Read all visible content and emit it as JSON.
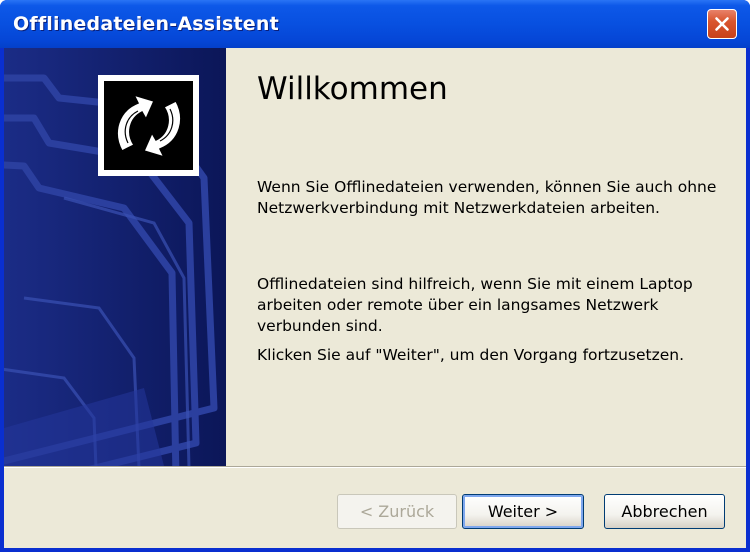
{
  "window": {
    "title": "Offlinedateien-Assistent",
    "close_icon": "close-icon",
    "close_color": "#d9562f",
    "titlebar_color": "#0850e0"
  },
  "banner": {
    "logo_icon": "sync-arrows-icon",
    "background_color": "#0f1f6e"
  },
  "content": {
    "heading": "Willkommen",
    "paragraphs": [
      "Wenn Sie Offlinedateien verwenden, können Sie auch ohne Netzwerkverbindung mit Netzwerkdateien arbeiten.",
      "Offlinedateien sind hilfreich, wenn Sie mit einem Laptop arbeiten oder remote über ein langsames Netzwerk verbunden sind.",
      "Klicken Sie auf \"Weiter\", um den Vorgang fortzusetzen."
    ]
  },
  "buttons": {
    "back": "< Zurück",
    "back_enabled": false,
    "next": "Weiter >",
    "cancel": "Abbrechen"
  }
}
